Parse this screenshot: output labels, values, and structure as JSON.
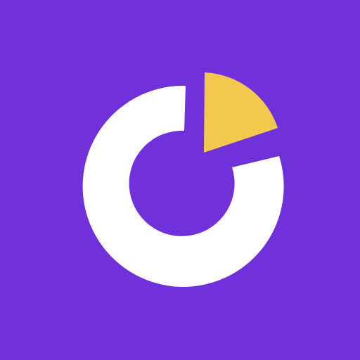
{
  "icon": {
    "name": "pie-chart-icon",
    "colors": {
      "background": "#7030DA",
      "ring": "#FFFFFF",
      "accent_slice": "#F2C94C"
    }
  }
}
